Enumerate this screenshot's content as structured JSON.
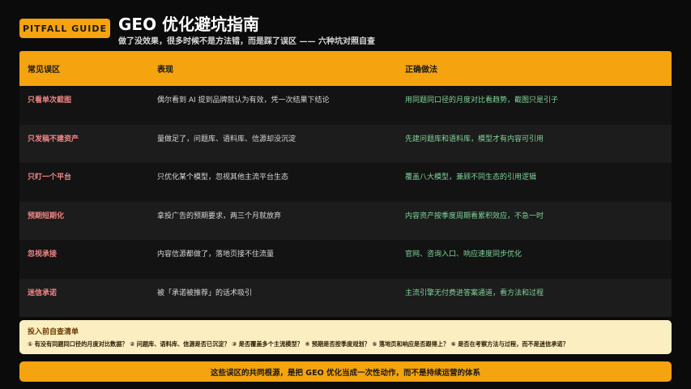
{
  "header": {
    "badge": "PITFALL GUIDE",
    "title": "GEO 优化避坑指南",
    "subtitle": "做了没效果，很多时候不是方法错，而是踩了误区 —— 六种坑对照自查"
  },
  "table": {
    "columns": [
      "常见误区",
      "表现",
      "正确做法"
    ],
    "rows": [
      {
        "pitfall": "只看单次截图",
        "symptom": "偶尔看到 AI 提到品牌就认为有效，凭一次结果下结论",
        "fix": "用同题同口径的月度对比看趋势，截图只是引子"
      },
      {
        "pitfall": "只发稿不建资产",
        "symptom": "量做足了，问题库、语料库、信源却没沉淀",
        "fix": "先建问题库和语料库，模型才有内容可引用"
      },
      {
        "pitfall": "只盯一个平台",
        "symptom": "只优化某个模型，忽视其他主流平台生态",
        "fix": "覆盖八大模型，兼顾不同生态的引用逻辑"
      },
      {
        "pitfall": "预期短期化",
        "symptom": "拿投广告的预期要求，两三个月就放弃",
        "fix": "内容资产按季度周期看累积效应，不急一时"
      },
      {
        "pitfall": "忽视承接",
        "symptom": "内容信源都做了，落地页接不住流量",
        "fix": "官网、咨询入口、响应速度同步优化"
      },
      {
        "pitfall": "迷信承诺",
        "symptom": "被「承诺被推荐」的话术吸引",
        "fix": "主流引擎无付费进答案通道，看方法和过程"
      }
    ]
  },
  "checklist": {
    "title": "投入前自查清单",
    "items": "① 有没有同题同口径的月度对比数据？ ② 问题库、语料库、信源是否已沉淀？ ③ 是否覆盖多个主流模型？ ④ 预期是否按季度规划？ ⑤ 落地页和响应是否跟得上？ ⑥ 是否在考察方法与过程，而不是迷信承诺？"
  },
  "footer": {
    "text": "这些误区的共同根源，是把 GEO 优化当成一次性动作，而不是持续运营的体系"
  },
  "colors": {
    "accent": "#f5a30e",
    "pitfall": "#f08585",
    "fix": "#7fd49a",
    "checklist_bg": "#fbefc2"
  }
}
